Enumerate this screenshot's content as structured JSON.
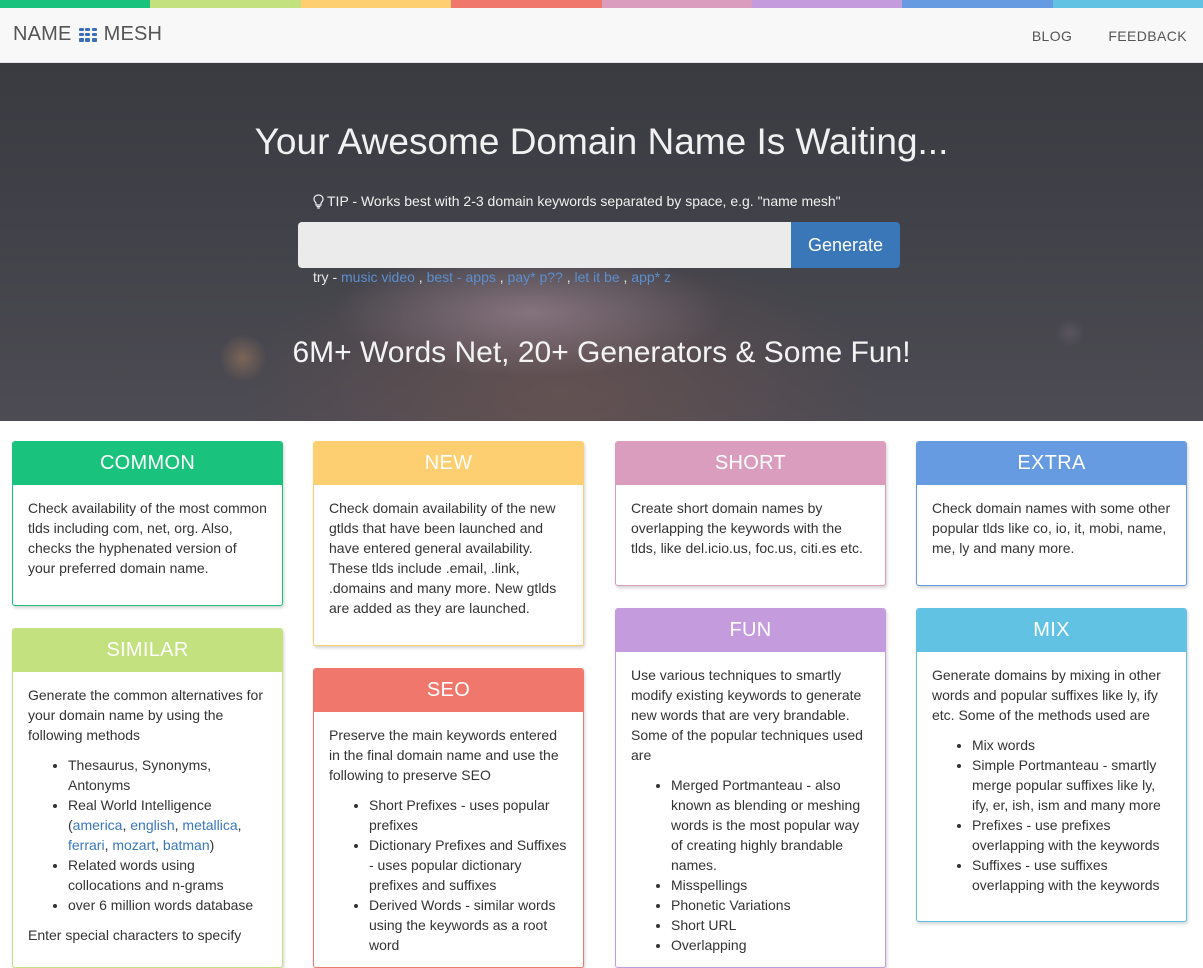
{
  "top_stripe": [
    "#19c37d",
    "#c4e17f",
    "#fecf71",
    "#f0776c",
    "#db9dbe",
    "#c49cde",
    "#669ae1",
    "#62c2e4"
  ],
  "nav": {
    "brand_left": "NAME",
    "brand_right": "MESH",
    "brand_icon": "grid-icon",
    "blog": "BLOG",
    "feedback": "FEEDBACK"
  },
  "hero": {
    "title": "Your Awesome Domain Name Is Waiting...",
    "tip_icon": "lightbulb-icon",
    "tip": "TIP - Works best with 2-3 domain keywords separated by space, e.g. \"name mesh\"",
    "search_value": "",
    "generate_label": "Generate",
    "try_label": "try -",
    "examples": [
      "music video",
      "best - apps",
      "pay* p??",
      "let it be",
      "app* z"
    ],
    "subtitle": "6M+ Words Net, 20+ Generators & Some Fun!"
  },
  "cards": {
    "common": {
      "title": "COMMON",
      "color": "#19c37d",
      "text": "Check availability of the most common tlds including com, net, org. Also, checks the hyphenated version of your preferred domain name."
    },
    "new": {
      "title": "NEW",
      "color": "#fecf71",
      "text": "Check domain availability of the new gtlds that have been launched and have entered general availability. These tlds include .email, .link, .domains and many more. New gtlds are added as they are launched."
    },
    "short": {
      "title": "SHORT",
      "color": "#db9dbe",
      "text": "Create short domain names by overlapping the keywords with the tlds, like del.icio.us, foc.us, citi.es etc."
    },
    "extra": {
      "title": "EXTRA",
      "color": "#669ae1",
      "text": "Check domain names with some other popular tlds like co, io, it, mobi, name, me, ly and many more."
    },
    "similar": {
      "title": "SIMILAR",
      "color": "#c4e17f",
      "text": "Generate the common alternatives for your domain name by using the following methods",
      "item1": "Thesaurus, Synonyms, Antonyms",
      "item2_prefix": "Real World Intelligence (",
      "links": [
        "america",
        "english",
        "metallica",
        "ferrari",
        "mozart",
        "batman"
      ],
      "item2_suffix": ")",
      "item3": "Related words using collocations and n-grams",
      "item4": "over 6 million words database",
      "footer": "Enter special characters to specify"
    },
    "seo": {
      "title": "SEO",
      "color": "#f0776c",
      "text": "Preserve the main keywords entered in the final domain name and use the following to preserve SEO",
      "items": [
        "Short Prefixes - uses popular prefixes",
        "Dictionary Prefixes and Suffixes - uses popular dictionary prefixes and suffixes",
        "Derived Words - similar words using the keywords as a root word"
      ]
    },
    "fun": {
      "title": "FUN",
      "color": "#c49cde",
      "text": "Use various techniques to smartly modify existing keywords to generate new words that are very brandable. Some of the popular techniques used are",
      "items": [
        "Merged Portmanteau - also known as blending or meshing words is the most popular way of creating highly brandable names.",
        "Misspellings",
        "Phonetic Variations",
        "Short URL",
        "Overlapping"
      ]
    },
    "mix": {
      "title": "MIX",
      "color": "#62c2e4",
      "text": "Generate domains by mixing in other words and popular suffixes like ly, ify etc. Some of the methods used are",
      "items": [
        "Mix words",
        "Simple Portmanteau - smartly merge popular suffixes like ly, ify, er, ish, ism and many more",
        "Prefixes - use prefixes overlapping with the keywords",
        "Suffixes - use suffixes overlapping with the keywords"
      ]
    }
  }
}
